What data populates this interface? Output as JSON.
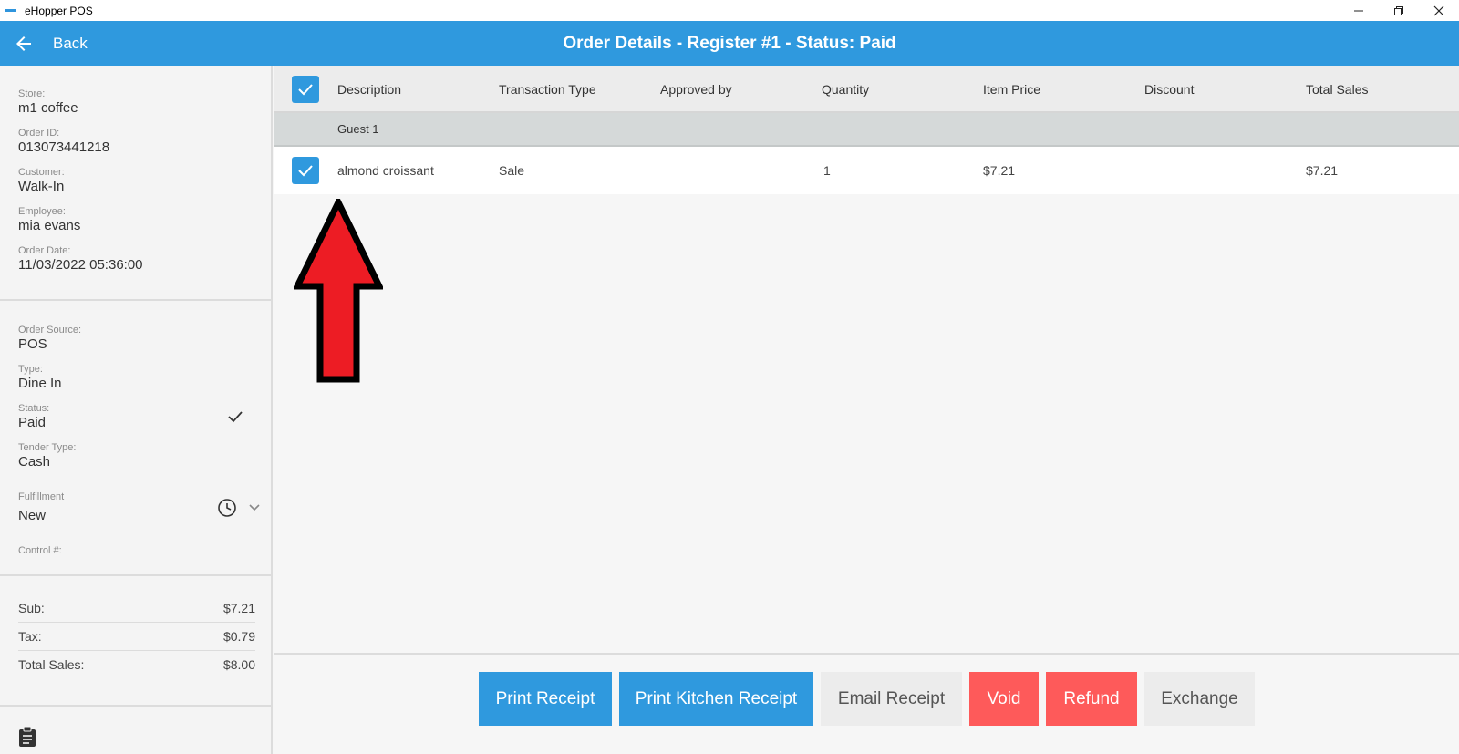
{
  "window": {
    "title": "eHopper POS"
  },
  "header": {
    "back_label": "Back",
    "title": "Order Details - Register #1 - Status: Paid"
  },
  "sidebar": {
    "store_label": "Store:",
    "store_value": "m1 coffee",
    "order_id_label": "Order ID:",
    "order_id_value": "013073441218",
    "customer_label": "Customer:",
    "customer_value": "Walk-In",
    "employee_label": "Employee:",
    "employee_value": "mia evans",
    "order_date_label": "Order Date:",
    "order_date_value": "11/03/2022 05:36:00",
    "order_source_label": "Order Source:",
    "order_source_value": "POS",
    "type_label": "Type:",
    "type_value": "Dine In",
    "status_label": "Status:",
    "status_value": "Paid",
    "tender_label": "Tender Type:",
    "tender_value": "Cash",
    "fulfillment_label": "Fulfillment",
    "fulfillment_value": "New",
    "control_label": "Control #:"
  },
  "summary": {
    "sub_label": "Sub:",
    "sub_value": "$7.21",
    "tax_label": "Tax:",
    "tax_value": "$0.79",
    "total_label": "Total Sales:",
    "total_value": "$8.00"
  },
  "table": {
    "columns": {
      "description": "Description",
      "transaction_type": "Transaction Type",
      "approved_by": "Approved by",
      "quantity": "Quantity",
      "item_price": "Item Price",
      "discount": "Discount",
      "total_sales": "Total Sales"
    },
    "guest_label": "Guest 1",
    "rows": [
      {
        "description": "almond croissant",
        "transaction_type": "Sale",
        "approved_by": "",
        "quantity": "1",
        "item_price": "$7.21",
        "discount": "",
        "total_sales": "$7.21"
      }
    ]
  },
  "actions": {
    "print_receipt": "Print Receipt",
    "print_kitchen_receipt": "Print Kitchen Receipt",
    "email_receipt": "Email Receipt",
    "void": "Void",
    "refund": "Refund",
    "exchange": "Exchange"
  },
  "colors": {
    "accent": "#2f99de",
    "danger": "#fe5a5a",
    "annotation_arrow": "#ed1c24"
  }
}
